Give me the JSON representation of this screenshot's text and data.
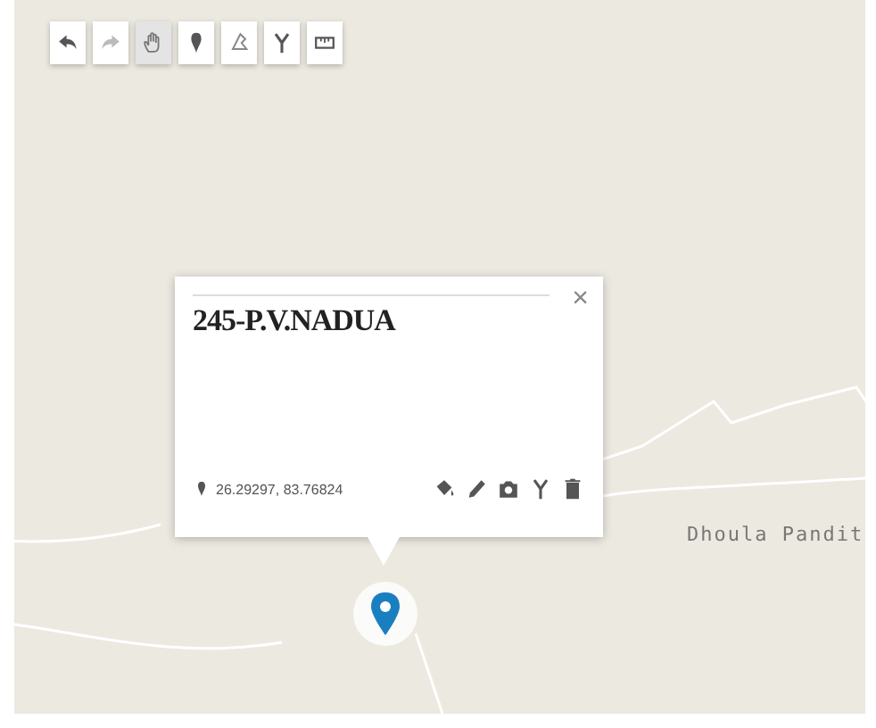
{
  "toolbar": {
    "tools": [
      {
        "kind": "undo",
        "selected": false
      },
      {
        "kind": "redo",
        "selected": false
      },
      {
        "kind": "hand",
        "selected": true
      },
      {
        "kind": "marker",
        "selected": false
      },
      {
        "kind": "polygon",
        "selected": false
      },
      {
        "kind": "fork",
        "selected": false
      },
      {
        "kind": "ruler",
        "selected": false
      }
    ]
  },
  "popup": {
    "title": "245-P.V.NADUA",
    "close": "×",
    "coordinates": "26.29297, 83.76824",
    "actions": [
      {
        "kind": "paint"
      },
      {
        "kind": "edit"
      },
      {
        "kind": "camera"
      },
      {
        "kind": "fork"
      },
      {
        "kind": "delete"
      }
    ]
  },
  "place_label": "Dhoula Pandit"
}
